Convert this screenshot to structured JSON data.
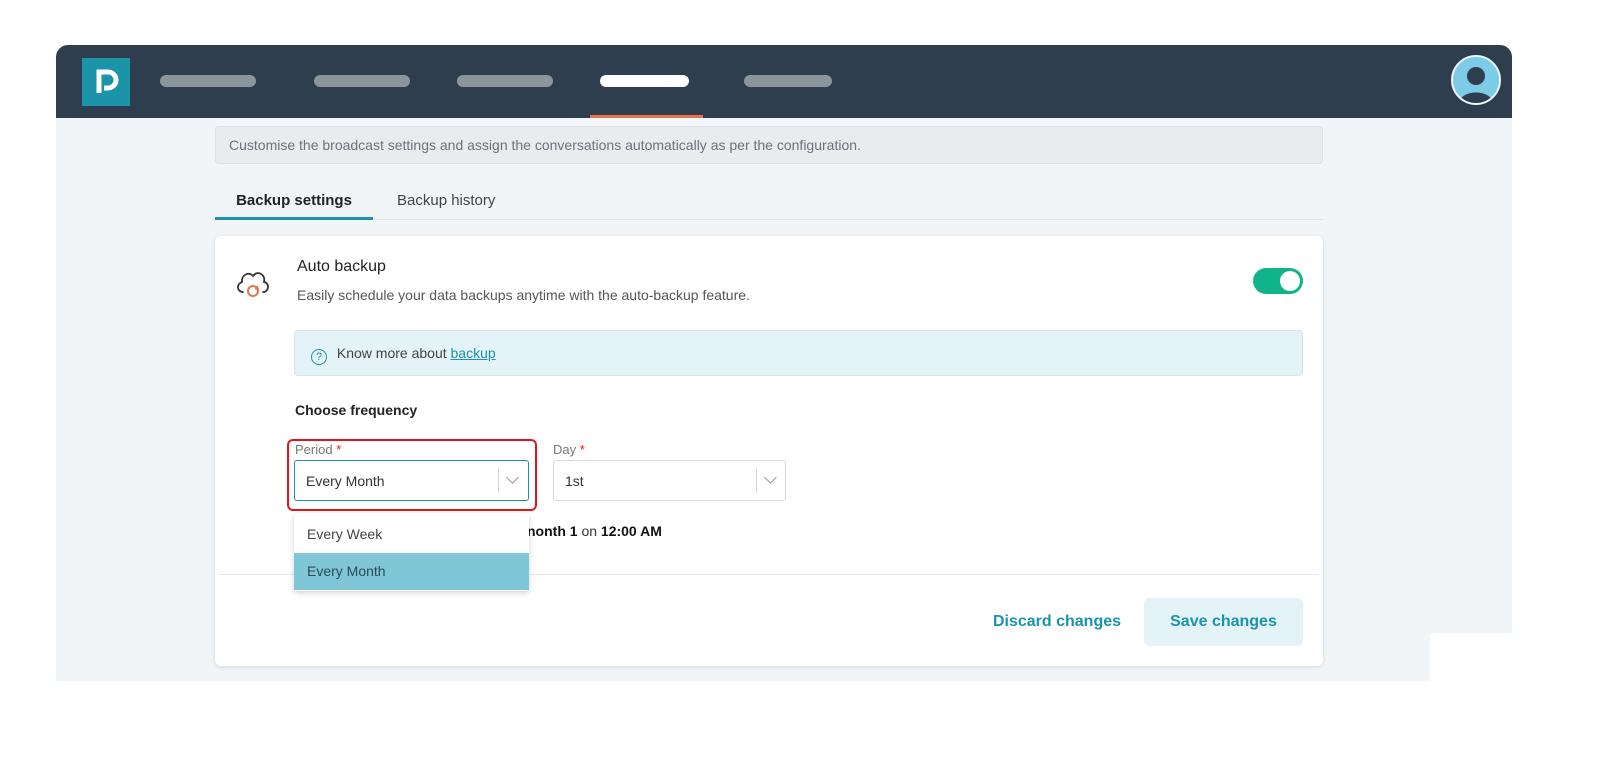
{
  "header": {
    "nav_items": [
      "",
      "",
      "",
      "",
      ""
    ],
    "active_nav_index": 3,
    "accent_color": "#e8734a",
    "bar_color": "#2f3e4f"
  },
  "page": {
    "info_text": "Customise the broadcast settings and assign the conversations automatically as per the configuration."
  },
  "tabs": [
    {
      "label": "Backup settings",
      "active": true
    },
    {
      "label": "Backup history",
      "active": false
    }
  ],
  "auto_backup": {
    "title": "Auto backup",
    "description": "Easily schedule your data backups anytime with the auto-backup feature.",
    "enabled": true,
    "toggle_color": "#11b48a"
  },
  "know_more": {
    "text": "Know more about",
    "link": "backup"
  },
  "frequency": {
    "title": "Choose frequency",
    "period_label": "Period",
    "period_value": "Every Month",
    "day_label": "Day",
    "day_value": "1st",
    "required_mark": "*",
    "schedule_partial": "nonth 1",
    "schedule_on": "on",
    "schedule_time": "12:00 AM"
  },
  "dropdown": {
    "options": [
      "Every Week",
      "Every Month"
    ],
    "selected_index": 1
  },
  "actions": {
    "discard_label": "Discard changes",
    "save_label": "Save changes"
  }
}
